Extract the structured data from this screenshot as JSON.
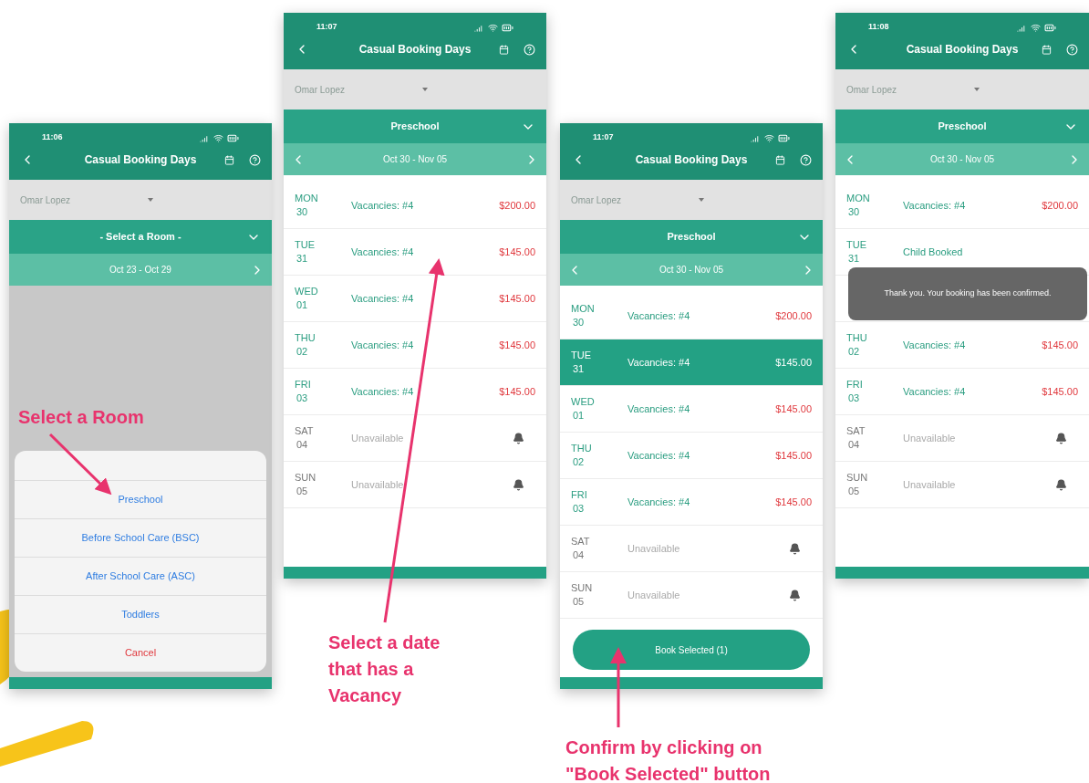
{
  "screens": [
    {
      "time": "11:06",
      "title": "Casual Booking Days",
      "person": "Omar Lopez",
      "room": "- Select a Room -",
      "week": "Oct 23 - Oct 29",
      "prev_arrow": false,
      "action_sheet": {
        "options": [
          {
            "label": "Preschool",
            "kind": "option"
          },
          {
            "label": "Before School Care (BSC)",
            "kind": "option"
          },
          {
            "label": "After School Care (ASC)",
            "kind": "option"
          },
          {
            "label": "Toddlers",
            "kind": "option"
          },
          {
            "label": "Cancel",
            "kind": "cancel"
          }
        ]
      }
    },
    {
      "time": "11:07",
      "title": "Casual Booking Days",
      "person": "Omar Lopez",
      "room": "Preschool",
      "week": "Oct 30 - Nov 05",
      "prev_arrow": true,
      "days": [
        {
          "day": "MON",
          "date": "30",
          "kind": "vacancy",
          "status": "Vacancies: #4",
          "price": "$200.00",
          "selected": false
        },
        {
          "day": "TUE",
          "date": "31",
          "kind": "vacancy",
          "status": "Vacancies: #4",
          "price": "$145.00",
          "selected": false
        },
        {
          "day": "WED",
          "date": "01",
          "kind": "vacancy",
          "status": "Vacancies: #4",
          "price": "$145.00",
          "selected": false
        },
        {
          "day": "THU",
          "date": "02",
          "kind": "vacancy",
          "status": "Vacancies: #4",
          "price": "$145.00",
          "selected": false
        },
        {
          "day": "FRI",
          "date": "03",
          "kind": "vacancy",
          "status": "Vacancies: #4",
          "price": "$145.00",
          "selected": false
        },
        {
          "day": "SAT",
          "date": "04",
          "kind": "unavailable",
          "status": "Unavailable",
          "selected": false
        },
        {
          "day": "SUN",
          "date": "05",
          "kind": "unavailable",
          "status": "Unavailable",
          "selected": false
        }
      ]
    },
    {
      "time": "11:07",
      "title": "Casual Booking Days",
      "person": "Omar Lopez",
      "room": "Preschool",
      "week": "Oct 30 - Nov 05",
      "prev_arrow": true,
      "days": [
        {
          "day": "MON",
          "date": "30",
          "kind": "vacancy",
          "status": "Vacancies: #4",
          "price": "$200.00",
          "selected": false
        },
        {
          "day": "TUE",
          "date": "31",
          "kind": "vacancy",
          "status": "Vacancies: #4",
          "price": "$145.00",
          "selected": true
        },
        {
          "day": "WED",
          "date": "01",
          "kind": "vacancy",
          "status": "Vacancies: #4",
          "price": "$145.00",
          "selected": false
        },
        {
          "day": "THU",
          "date": "02",
          "kind": "vacancy",
          "status": "Vacancies: #4",
          "price": "$145.00",
          "selected": false
        },
        {
          "day": "FRI",
          "date": "03",
          "kind": "vacancy",
          "status": "Vacancies: #4",
          "price": "$145.00",
          "selected": false
        },
        {
          "day": "SAT",
          "date": "04",
          "kind": "unavailable",
          "status": "Unavailable",
          "selected": false
        },
        {
          "day": "SUN",
          "date": "05",
          "kind": "unavailable",
          "status": "Unavailable",
          "selected": false
        }
      ],
      "book_button": "Book Selected (1)"
    },
    {
      "time": "11:08",
      "title": "Casual Booking Days",
      "person": "Omar Lopez",
      "room": "Preschool",
      "week": "Oct 30 - Nov 05",
      "prev_arrow": true,
      "days": [
        {
          "day": "MON",
          "date": "30",
          "kind": "vacancy",
          "status": "Vacancies: #4",
          "price": "$200.00",
          "selected": false
        },
        {
          "day": "TUE",
          "date": "31",
          "kind": "booked",
          "status": "Child Booked",
          "selected": false
        },
        {
          "kind": "covered",
          "selected": false
        },
        {
          "day": "THU",
          "date": "02",
          "kind": "vacancy",
          "status": "Vacancies: #4",
          "price": "$145.00",
          "selected": false
        },
        {
          "day": "FRI",
          "date": "03",
          "kind": "vacancy",
          "status": "Vacancies: #4",
          "price": "$145.00",
          "selected": false
        },
        {
          "day": "SAT",
          "date": "04",
          "kind": "unavailable",
          "status": "Unavailable",
          "selected": false
        },
        {
          "day": "SUN",
          "date": "05",
          "kind": "unavailable",
          "status": "Unavailable",
          "selected": false
        }
      ],
      "toast": "Thank you. Your booking has been confirmed."
    }
  ],
  "annotations": [
    {
      "text": "Select a Room"
    },
    {
      "text": "Select a date that has a Vacancy"
    },
    {
      "text": "Confirm by clicking on \"Book Selected\" button"
    }
  ]
}
